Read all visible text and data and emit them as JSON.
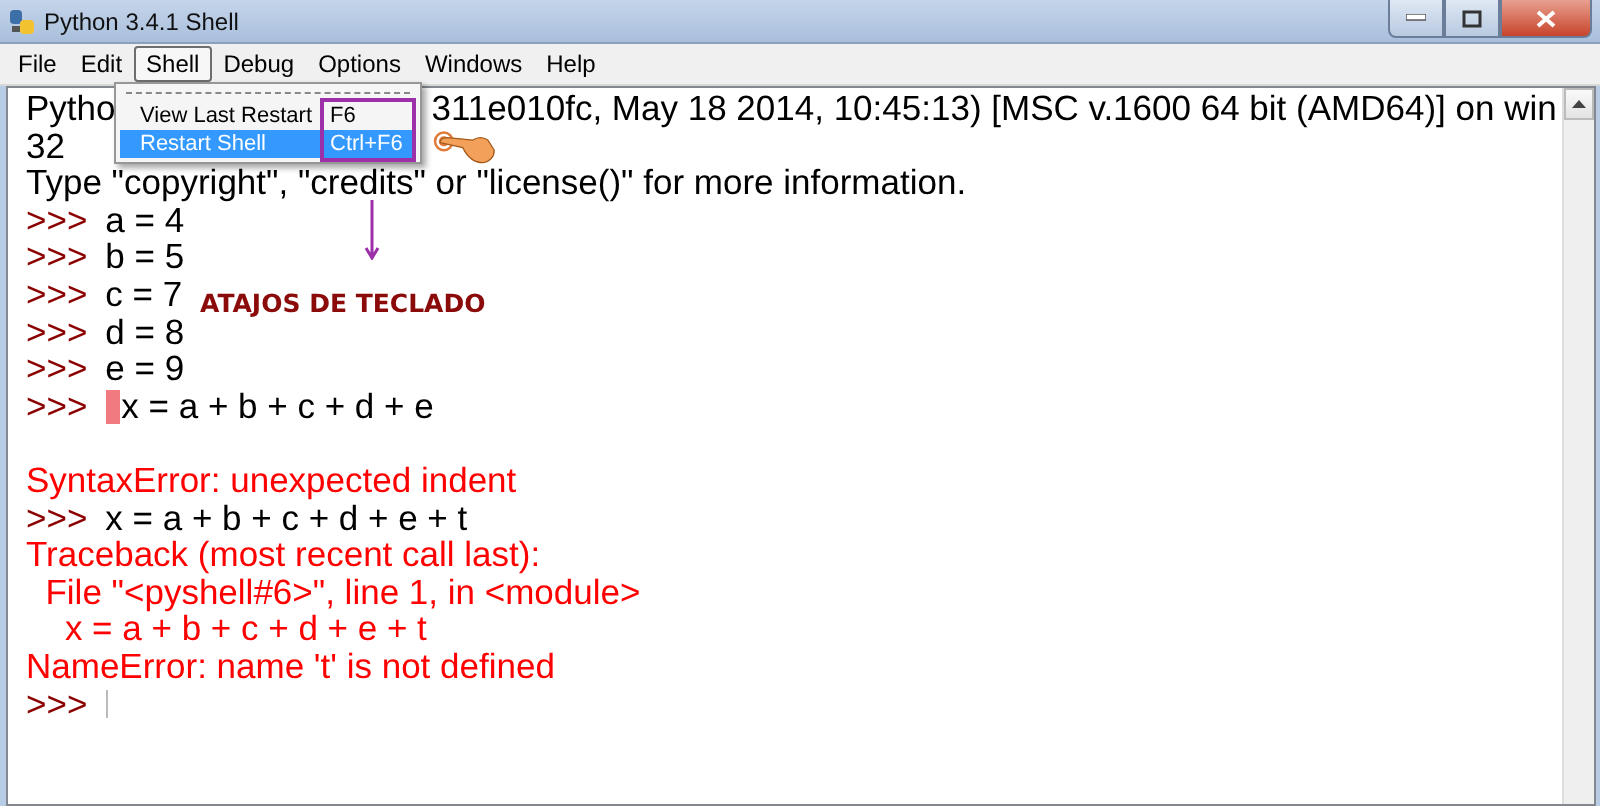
{
  "window": {
    "title": "Python 3.4.1 Shell"
  },
  "menu_bar": [
    {
      "label": "File",
      "selected": false
    },
    {
      "label": "Edit",
      "selected": false
    },
    {
      "label": "Shell",
      "selected": true
    },
    {
      "label": "Debug",
      "selected": false
    },
    {
      "label": "Options",
      "selected": false
    },
    {
      "label": "Windows",
      "selected": false
    },
    {
      "label": "Help",
      "selected": false
    }
  ],
  "shell_menu": [
    {
      "label": "View Last Restart",
      "shortcut": "F6",
      "selected": false
    },
    {
      "label": "Restart Shell",
      "shortcut": "Ctrl+F6",
      "selected": true
    }
  ],
  "lines": [
    {
      "kind": "covered",
      "before": "Pytho",
      "after": "311e010fc, May 18 2014, 10:45:13) [MSC v.1600 64 bit (AMD64)] on win"
    },
    {
      "kind": "output",
      "text": "32"
    },
    {
      "kind": "output",
      "text": "Type \"copyright\", \"credits\" or \"license()\" for more information."
    },
    {
      "kind": "input",
      "prompt": ">>>",
      "code": "a = 4",
      "error_mark": false
    },
    {
      "kind": "input",
      "prompt": ">>>",
      "code": "b = 5",
      "error_mark": false
    },
    {
      "kind": "input",
      "prompt": ">>>",
      "code": "c = 7",
      "error_mark": false
    },
    {
      "kind": "input",
      "prompt": ">>>",
      "code": "d = 8",
      "error_mark": false
    },
    {
      "kind": "input",
      "prompt": ">>>",
      "code": "e = 9",
      "error_mark": false
    },
    {
      "kind": "input",
      "prompt": ">>>",
      "code": "x = a + b + c + d + e",
      "error_mark": true
    },
    {
      "kind": "blank"
    },
    {
      "kind": "error",
      "text": "SyntaxError: unexpected indent"
    },
    {
      "kind": "input",
      "prompt": ">>>",
      "code": "x = a + b + c + d + e + t",
      "error_mark": false
    },
    {
      "kind": "error",
      "text": "Traceback (most recent call last):"
    },
    {
      "kind": "error",
      "text": "  File \"<pyshell#6>\", line 1, in <module>"
    },
    {
      "kind": "error",
      "text": "    x = a + b + c + d + e + t"
    },
    {
      "kind": "error",
      "text": "NameError: name 't' is not defined"
    },
    {
      "kind": "prompt",
      "prompt": ">>>",
      "cursor": true
    }
  ],
  "annotation": {
    "label": "ATAJOS DE TECLADO"
  }
}
